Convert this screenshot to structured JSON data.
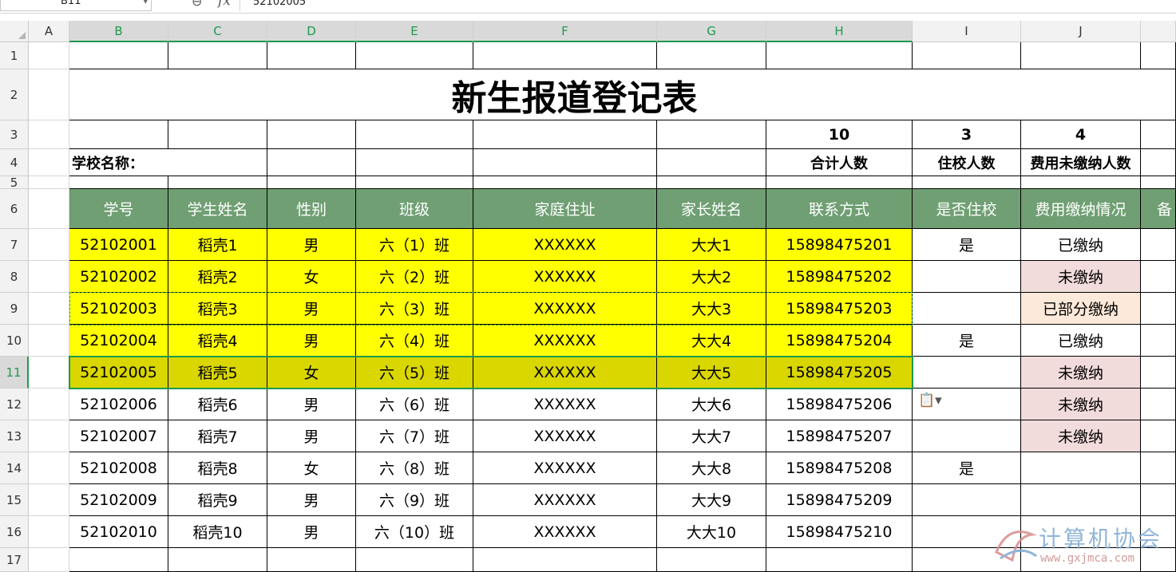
{
  "formula_bar": {
    "name_box": "B11",
    "formula": "52102005"
  },
  "column_headers": [
    "A",
    "B",
    "C",
    "D",
    "E",
    "F",
    "G",
    "H",
    "I",
    "J"
  ],
  "row_numbers": [
    "1",
    "2",
    "3",
    "4",
    "5",
    "6",
    "7",
    "8",
    "9",
    "10",
    "11",
    "12",
    "13",
    "14",
    "15",
    "16",
    "17"
  ],
  "title": "新生报道登记表",
  "summary": {
    "school_label": "学校名称：",
    "total_value": "10",
    "total_label": "合计人数",
    "resident_value": "3",
    "resident_label": "住校人数",
    "unpaid_value": "4",
    "unpaid_label": "费用未缴纳人数"
  },
  "table_headers": [
    "学号",
    "学生姓名",
    "性别",
    "班级",
    "家庭住址",
    "家长姓名",
    "联系方式",
    "是否住校",
    "费用缴纳情况",
    "备"
  ],
  "rows": [
    {
      "id": "52102001",
      "name": "稻壳1",
      "gender": "男",
      "class": "六（1）班",
      "address": "XXXXXX",
      "parent": "大大1",
      "phone": "15898475201",
      "resident": "是",
      "fee": "已缴纳"
    },
    {
      "id": "52102002",
      "name": "稻壳2",
      "gender": "女",
      "class": "六（2）班",
      "address": "XXXXXX",
      "parent": "大大2",
      "phone": "15898475202",
      "resident": "",
      "fee": "未缴纳"
    },
    {
      "id": "52102003",
      "name": "稻壳3",
      "gender": "男",
      "class": "六（3）班",
      "address": "XXXXXX",
      "parent": "大大3",
      "phone": "15898475203",
      "resident": "",
      "fee": "已部分缴纳"
    },
    {
      "id": "52102004",
      "name": "稻壳4",
      "gender": "男",
      "class": "六（4）班",
      "address": "XXXXXX",
      "parent": "大大4",
      "phone": "15898475204",
      "resident": "是",
      "fee": "已缴纳"
    },
    {
      "id": "52102005",
      "name": "稻壳5",
      "gender": "女",
      "class": "六（5）班",
      "address": "XXXXXX",
      "parent": "大大5",
      "phone": "15898475205",
      "resident": "",
      "fee": "未缴纳"
    },
    {
      "id": "52102006",
      "name": "稻壳6",
      "gender": "男",
      "class": "六（6）班",
      "address": "XXXXXX",
      "parent": "大大6",
      "phone": "15898475206",
      "resident": "",
      "fee": "未缴纳"
    },
    {
      "id": "52102007",
      "name": "稻壳7",
      "gender": "男",
      "class": "六（7）班",
      "address": "XXXXXX",
      "parent": "大大7",
      "phone": "15898475207",
      "resident": "",
      "fee": "未缴纳"
    },
    {
      "id": "52102008",
      "name": "稻壳8",
      "gender": "女",
      "class": "六（8）班",
      "address": "XXXXXX",
      "parent": "大大8",
      "phone": "15898475208",
      "resident": "是",
      "fee": ""
    },
    {
      "id": "52102009",
      "name": "稻壳9",
      "gender": "男",
      "class": "六（9）班",
      "address": "XXXXXX",
      "parent": "大大9",
      "phone": "15898475209",
      "resident": "",
      "fee": ""
    },
    {
      "id": "52102010",
      "name": "稻壳10",
      "gender": "男",
      "class": "六（10）班",
      "address": "XXXXXX",
      "parent": "大大10",
      "phone": "15898475210",
      "resident": "",
      "fee": ""
    }
  ],
  "watermark": {
    "text": "计算机协会",
    "url": "www.gxjmca.com"
  },
  "colors": {
    "header_green": "#6f9f72",
    "highlight_yellow": "#ffff00",
    "selected_yellow": "#d9d600",
    "unpaid_pink": "#f2dcdb",
    "partial_peach": "#fde9d9",
    "selection_green": "#1e9a4e"
  }
}
